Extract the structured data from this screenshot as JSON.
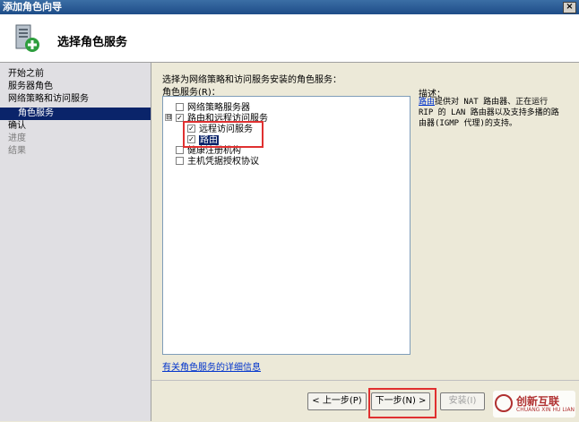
{
  "window": {
    "title": "添加角色向导",
    "close_label": "×"
  },
  "header": {
    "page_title": "选择角色服务",
    "icon": "server-role-icon"
  },
  "sidebar": {
    "items": [
      {
        "label": "开始之前",
        "state": "normal"
      },
      {
        "label": "服务器角色",
        "state": "normal"
      },
      {
        "label": "网络策略和访问服务",
        "state": "normal"
      },
      {
        "label": "角色服务",
        "state": "selected"
      },
      {
        "label": "确认",
        "state": "normal"
      },
      {
        "label": "进度",
        "state": "disabled"
      },
      {
        "label": "结果",
        "state": "disabled"
      }
    ]
  },
  "main": {
    "instruction": "选择为网络策略和访问服务安装的角色服务：",
    "role_services_label": "角色服务(R)：",
    "tree": [
      {
        "label": "网络策略服务器",
        "checked": false,
        "level": 1
      },
      {
        "label": "路由和远程访问服务",
        "checked": true,
        "level": 1,
        "expander": "⊟"
      },
      {
        "label": "远程访问服务",
        "checked": true,
        "level": 2
      },
      {
        "label": "路由",
        "checked": true,
        "level": 2,
        "selected": true
      },
      {
        "label": "健康注册机构",
        "checked": false,
        "level": 1
      },
      {
        "label": "主机凭据授权协议",
        "checked": false,
        "level": 1
      }
    ],
    "more_info_link": "有关角色服务的详细信息",
    "description": {
      "title": "描述：",
      "link": "路由",
      "text": "提供对 NAT 路由器、正在运行 RIP 的 LAN 路由器以及支持多播的路由器(IGMP 代理)的支持。"
    }
  },
  "buttons": {
    "back": "< 上一步(P)",
    "next": "下一步(N) >",
    "install": "安装(I)"
  },
  "watermark": {
    "text": "创新互联",
    "sub": "CHUANG XIN HU LIAN"
  },
  "colors": {
    "highlight": "#0a246a",
    "annotation_red": "#e03030"
  }
}
